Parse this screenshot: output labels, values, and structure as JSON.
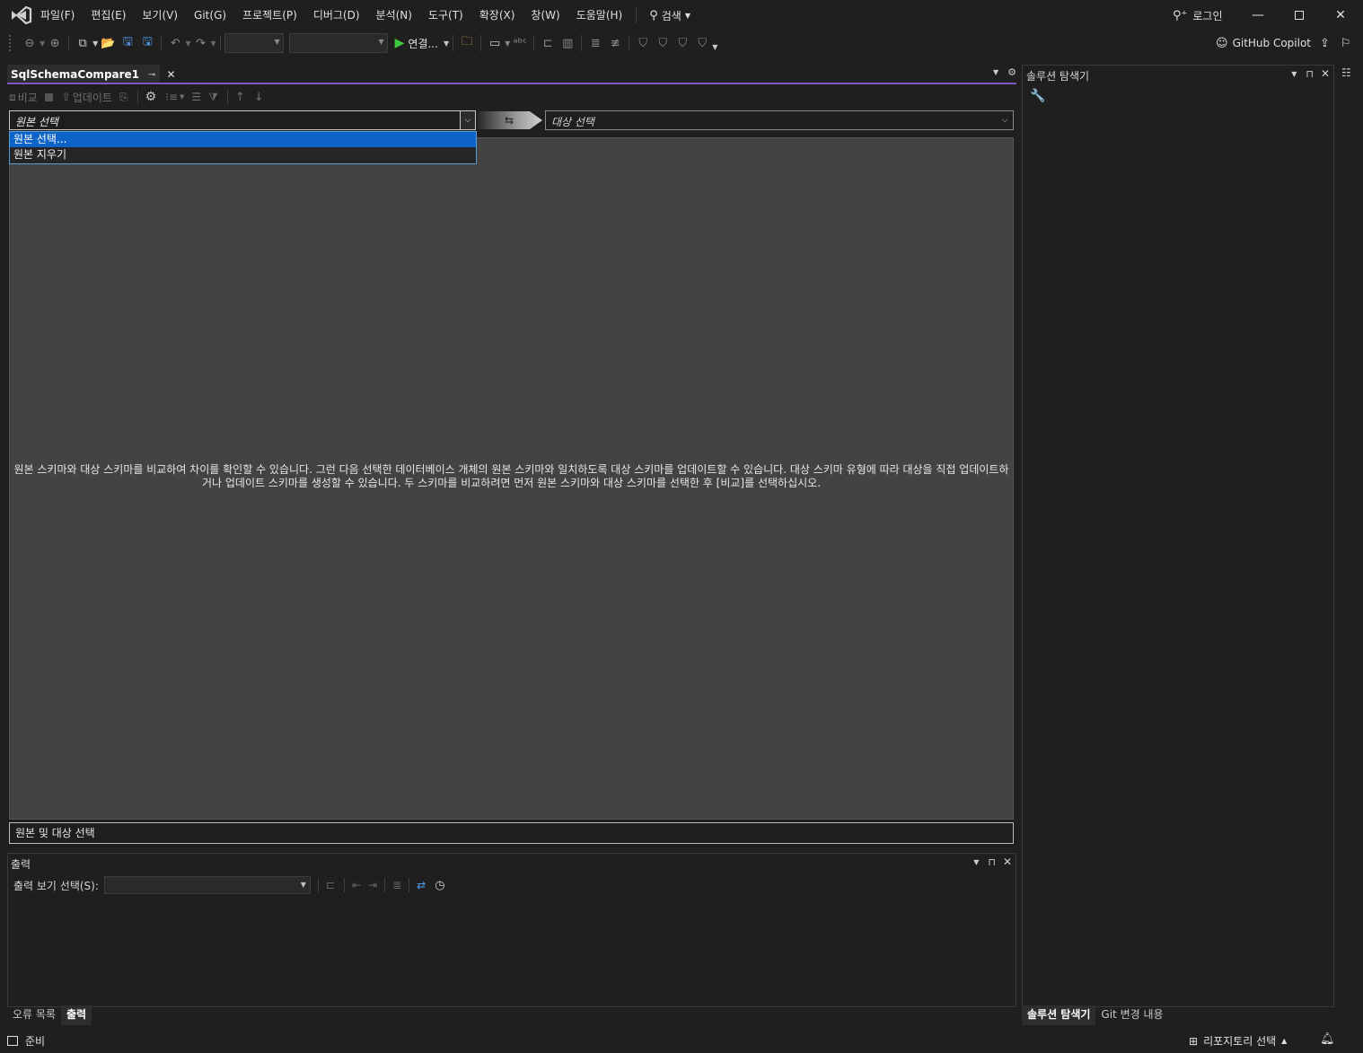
{
  "menu": {
    "items": [
      "파일(F)",
      "편집(E)",
      "보기(V)",
      "Git(G)",
      "프로젝트(P)",
      "디버그(D)",
      "분석(N)",
      "도구(T)",
      "확장(X)",
      "창(W)",
      "도움말(H)"
    ],
    "search_label": "검색"
  },
  "titlebar": {
    "login_label": "로그인",
    "minimize_icon": "minimize-icon",
    "maximize_icon": "maximize-icon",
    "close_icon": "close-icon"
  },
  "toolbar": {
    "run_label": "연결...",
    "copilot_label": "GitHub Copilot"
  },
  "document": {
    "tab_title": "SqlSchemaCompare1"
  },
  "schema_compare": {
    "compare_label": "비교",
    "update_label": "업데이트",
    "source_placeholder": "원본 선택",
    "target_placeholder": "대상 선택",
    "source_options": [
      "원본 선택...",
      "원본 지우기"
    ],
    "selected_option_index": 0,
    "message": "원본 스키마와 대상 스키마를 비교하여 차이를 확인할 수 있습니다. 그런 다음 선택한 데이터베이스 개체의 원본 스키마와 일치하도록 대상 스키마를 업데이트할 수 있습니다. 대상 스키마 유형에 따라 대상을 직접 업데이트하거나 업데이트 스키마를 생성할 수 있습니다. 두 스키마를 비교하려면 먼저 원본 스키마와 대상 스키마를 선택한 후 [비교]를 선택하십시오.",
    "status_text": "원본 및 대상 선택"
  },
  "output": {
    "title": "출력",
    "show_output_label": "출력 보기 선택(S):",
    "show_output_value": ""
  },
  "bottom_tabs": [
    {
      "label": "오류 목록",
      "active": false
    },
    {
      "label": "출력",
      "active": true
    }
  ],
  "solution_explorer": {
    "title": "솔루션 탐색기",
    "tabs": [
      {
        "label": "솔루션 탐색기",
        "active": true
      },
      {
        "label": "Git 변경 내용",
        "active": false
      }
    ]
  },
  "statusbar": {
    "ready_label": "준비",
    "repo_label": "리포지토리 선택"
  },
  "colors": {
    "accent": "#7e57c2",
    "selection": "#0e63c9",
    "canvas": "#434343",
    "background": "#1f1f1f"
  }
}
